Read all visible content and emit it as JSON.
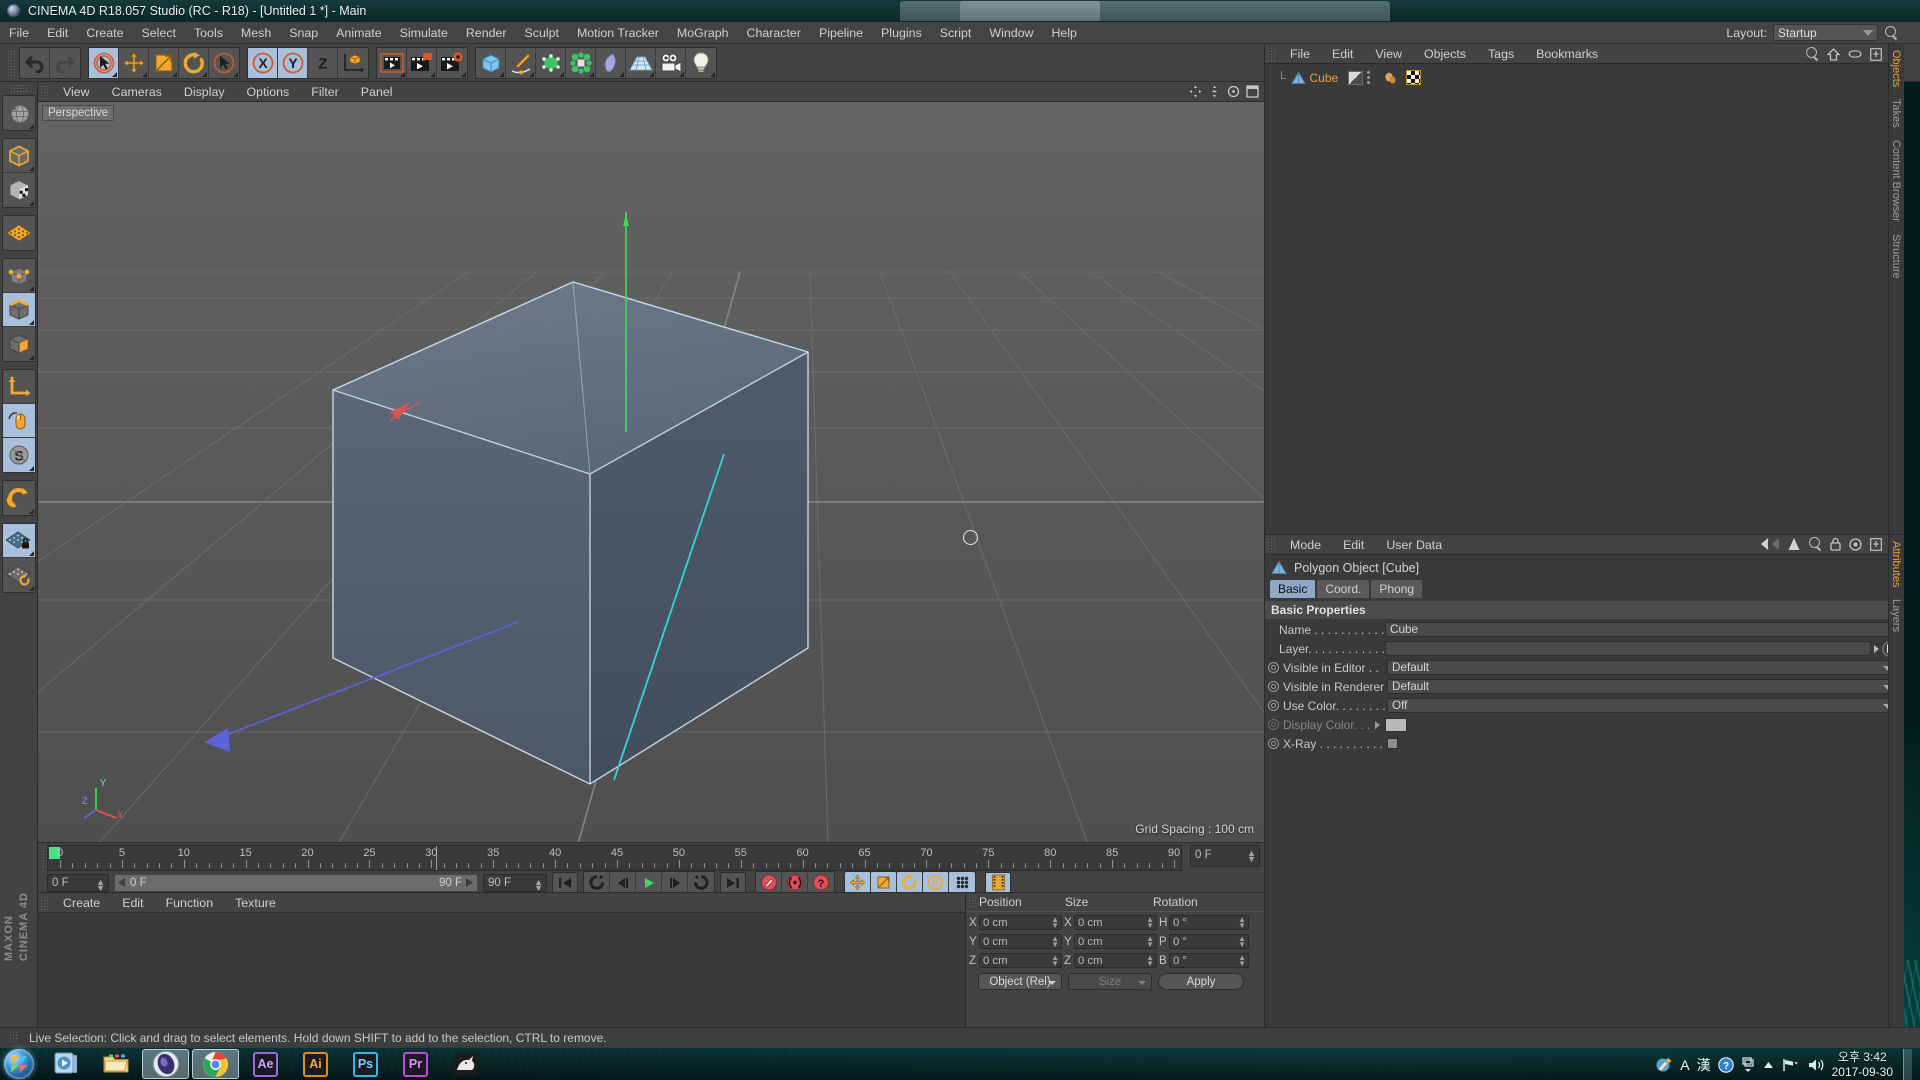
{
  "window": {
    "title": "CINEMA 4D R18.057 Studio (RC - R18) - [Untitled 1 *] - Main",
    "logo_icon": "c4d-logo"
  },
  "menubar": {
    "items": [
      "File",
      "Edit",
      "Create",
      "Select",
      "Tools",
      "Mesh",
      "Snap",
      "Animate",
      "Simulate",
      "Render",
      "Sculpt",
      "Motion Tracker",
      "MoGraph",
      "Character",
      "Pipeline",
      "Plugins",
      "Script",
      "Window",
      "Help"
    ],
    "layout_label": "Layout:",
    "layout_value": "Startup",
    "search_icon": "search-icon"
  },
  "toolbar": {
    "groups": [
      {
        "name": "history",
        "buttons": [
          {
            "icon": "undo-icon",
            "label": "Undo",
            "active": false
          },
          {
            "icon": "redo-icon",
            "label": "Redo",
            "active": false
          }
        ]
      },
      {
        "name": "selection-transform",
        "buttons": [
          {
            "icon": "live-selection-icon",
            "label": "Live Selection",
            "active": true
          },
          {
            "icon": "move-icon",
            "label": "Move",
            "active": false
          },
          {
            "icon": "scale-icon",
            "label": "Scale",
            "active": false
          },
          {
            "icon": "rotate-icon",
            "label": "Rotate",
            "active": false
          },
          {
            "icon": "cursor-select-icon",
            "label": "Selection Mode",
            "active": false
          }
        ]
      },
      {
        "name": "axis-lock",
        "buttons": [
          {
            "icon": "x-axis-icon",
            "label": "X",
            "active": true
          },
          {
            "icon": "y-axis-icon",
            "label": "Y",
            "active": true
          },
          {
            "icon": "z-axis-icon",
            "label": "Z",
            "active": false
          },
          {
            "icon": "world-object-axis-icon",
            "label": "World/Object",
            "active": false
          }
        ]
      },
      {
        "name": "render",
        "buttons": [
          {
            "icon": "render-view-icon",
            "label": "Render View",
            "active": false
          },
          {
            "icon": "render-region-icon",
            "label": "Render to Picture Viewer",
            "active": false
          },
          {
            "icon": "render-settings-icon",
            "label": "Edit Render Settings",
            "active": false
          }
        ]
      },
      {
        "name": "create",
        "buttons": [
          {
            "icon": "cube-primitive-icon",
            "label": "Add Cube Object",
            "active": false
          },
          {
            "icon": "spline-pen-icon",
            "label": "Add Spline",
            "active": false
          },
          {
            "icon": "generator-icon",
            "label": "Add Generator",
            "active": false
          },
          {
            "icon": "deformer-icon",
            "label": "Add Deformer",
            "active": false
          },
          {
            "icon": "environment-icon",
            "label": "Scene Object",
            "active": false
          },
          {
            "icon": "floor-icon",
            "label": "Scene Floor",
            "active": false
          },
          {
            "icon": "camera-icon",
            "label": "Add Camera",
            "active": false
          },
          {
            "icon": "light-icon",
            "label": "Add Light",
            "active": false
          }
        ]
      }
    ]
  },
  "leftbar": {
    "groups": [
      [
        {
          "icon": "globe-undo-icon",
          "label": "Undo View",
          "active": false
        }
      ],
      [
        {
          "icon": "model-mode-icon",
          "label": "Model Mode",
          "active": false
        },
        {
          "icon": "texture-mode-icon",
          "label": "Texture Mode",
          "active": false
        }
      ],
      [
        {
          "icon": "workplane-icon",
          "label": "Workplane",
          "active": false
        }
      ],
      [
        {
          "icon": "points-mode-icon",
          "label": "Points",
          "active": false
        },
        {
          "icon": "edges-mode-icon",
          "label": "Edges",
          "active": true
        },
        {
          "icon": "polygons-mode-icon",
          "label": "Polygons",
          "active": false
        }
      ],
      [
        {
          "icon": "axis-modify-icon",
          "label": "Enable Axis Modification",
          "active": false
        },
        {
          "icon": "viewport-solo-icon",
          "label": "Viewport Solo",
          "active": true
        },
        {
          "icon": "soft-selection-icon",
          "label": "Soft Selection",
          "active": true
        }
      ],
      [
        {
          "icon": "magnet-icon",
          "label": "Magnet",
          "active": false
        }
      ],
      [
        {
          "icon": "workplane-lock-icon",
          "label": "Lock Workplane",
          "active": true
        },
        {
          "icon": "workplane-rotate-icon",
          "label": "Planar Workplane",
          "active": false
        }
      ]
    ],
    "brand_line1": "MAXON",
    "brand_line2": "CINEMA 4D"
  },
  "viewport": {
    "menu": [
      "View",
      "Cameras",
      "Display",
      "Options",
      "Filter",
      "Panel"
    ],
    "label": "Perspective",
    "grid_spacing": "Grid Spacing : 100 cm",
    "axis_gizmo": {
      "x": "X",
      "y": "Y",
      "z": "Z"
    },
    "icons": [
      "pan-icon",
      "zoom-icon",
      "rotate-view-icon",
      "maximize-view-icon"
    ]
  },
  "timeline": {
    "ticks": [
      0,
      5,
      10,
      15,
      20,
      25,
      30,
      35,
      40,
      45,
      50,
      55,
      60,
      65,
      70,
      75,
      80,
      85,
      90
    ],
    "current_frame": "0 F",
    "range_start": "0 F",
    "range_end": "90 F",
    "preview_end": "90 F",
    "transport": [
      {
        "icon": "go-to-start-icon",
        "label": "Go to Start",
        "active": false
      },
      {
        "icon": "step-back-keyframe-icon",
        "label": "Go to Previous Key",
        "active": false
      },
      {
        "icon": "step-back-frame-icon",
        "label": "Go to Previous Frame",
        "active": false
      },
      {
        "icon": "play-icon",
        "label": "Play Forwards",
        "active": false
      },
      {
        "icon": "step-forward-frame-icon",
        "label": "Go to Next Frame",
        "active": false
      },
      {
        "icon": "step-forward-keyframe-icon",
        "label": "Go to Next Key",
        "active": false
      },
      {
        "icon": "go-to-end-icon",
        "label": "Go to End",
        "active": false
      }
    ],
    "record": [
      {
        "icon": "record-key-icon",
        "label": "Record Active Objects",
        "active": false
      },
      {
        "icon": "autokey-icon",
        "label": "Autokeying",
        "active": false
      },
      {
        "icon": "keyframe-selection-icon",
        "label": "Keyframe Selection",
        "active": false
      }
    ],
    "params": [
      {
        "icon": "key-position-icon",
        "label": "Position",
        "active": true
      },
      {
        "icon": "key-scale-icon",
        "label": "Scale",
        "active": true
      },
      {
        "icon": "key-rotation-icon",
        "label": "Rotation",
        "active": true
      },
      {
        "icon": "key-param-icon",
        "label": "Parameter",
        "active": true
      },
      {
        "icon": "key-pla-icon",
        "label": "Point Level Animation",
        "active": true
      }
    ],
    "extra": [
      {
        "icon": "timeline-toggle-icon",
        "label": "Animation Mode",
        "active": true
      }
    ]
  },
  "material_manager": {
    "menu": [
      "Create",
      "Edit",
      "Function",
      "Texture"
    ],
    "materials": []
  },
  "coordinates": {
    "headers": [
      "Position",
      "Size",
      "Rotation"
    ],
    "rows": [
      {
        "pos_axis": "X",
        "pos_value": "0 cm",
        "size_axis": "X",
        "size_value": "0 cm",
        "rot_axis": "H",
        "rot_value": "0 °"
      },
      {
        "pos_axis": "Y",
        "pos_value": "0 cm",
        "size_axis": "Y",
        "size_value": "0 cm",
        "rot_axis": "P",
        "rot_value": "0 °"
      },
      {
        "pos_axis": "Z",
        "pos_value": "0 cm",
        "size_axis": "Z",
        "size_value": "0 cm",
        "rot_axis": "B",
        "rot_value": "0 °"
      }
    ],
    "mode_dropdown": "Object (Rel)",
    "size_dropdown": "Size",
    "apply_button": "Apply"
  },
  "object_manager": {
    "menu": [
      "File",
      "Edit",
      "View",
      "Objects",
      "Tags",
      "Bookmarks"
    ],
    "header_icons": [
      "search-icon",
      "home-icon",
      "eye-icon",
      "fit-icon"
    ],
    "objects": [
      {
        "name": "Cube",
        "icon": "polygon-object-icon",
        "tags": [
          "display-tag",
          "phong-tag",
          "texture-tag"
        ]
      }
    ],
    "side_tabs": [
      "Objects",
      "Takes",
      "Content Browser",
      "Structure"
    ]
  },
  "attribute_manager": {
    "menu": [
      "Mode",
      "Edit",
      "User Data"
    ],
    "header_icons": [
      "back-icon",
      "forward-icon",
      "up-icon",
      "search-icon",
      "lock-icon",
      "target-icon",
      "fit-icon"
    ],
    "object_title": "Polygon Object [Cube]",
    "object_icon": "polygon-object-icon",
    "tabs": [
      {
        "label": "Basic",
        "active": true
      },
      {
        "label": "Coord.",
        "active": false
      },
      {
        "label": "Phong",
        "active": false
      }
    ],
    "section_title": "Basic Properties",
    "properties": [
      {
        "label": "Name . . . . . . . . . . .",
        "type": "text",
        "value": "Cube",
        "radio": false,
        "dim": false
      },
      {
        "label": "Layer. . . . . . . . . . . .",
        "type": "layer",
        "value": "",
        "radio": false,
        "dim": false
      },
      {
        "label": "Visible in Editor . .",
        "type": "dropdown",
        "value": "Default",
        "radio": true,
        "dim": false
      },
      {
        "label": "Visible in Renderer",
        "type": "dropdown",
        "value": "Default",
        "radio": true,
        "dim": false
      },
      {
        "label": "Use Color. . . . . . . .",
        "type": "dropdown",
        "value": "Off",
        "radio": true,
        "dim": false
      },
      {
        "label": "Display Color. . . ",
        "type": "color",
        "value": "",
        "radio": true,
        "dim": true
      },
      {
        "label": "X-Ray . . . . . . . . . . .",
        "type": "checkbox",
        "value": "",
        "radio": true,
        "dim": false
      }
    ],
    "side_tabs": [
      "Attributes",
      "Layers"
    ]
  },
  "statusbar": {
    "message": "Live Selection: Click and drag to select elements. Hold down SHIFT to add to the selection, CTRL to remove."
  },
  "taskbar": {
    "start_label": "Start",
    "items": [
      {
        "icon": "windows-media-player-icon",
        "label": "Windows Media Player",
        "active": false
      },
      {
        "icon": "file-explorer-icon",
        "label": "File Explorer",
        "active": false
      },
      {
        "icon": "cinema4d-icon",
        "label": "CINEMA 4D",
        "active": true
      },
      {
        "icon": "chrome-icon",
        "label": "Google Chrome",
        "active": true
      },
      {
        "icon": "after-effects-icon",
        "label": "Ae",
        "active": false
      },
      {
        "icon": "illustrator-icon",
        "label": "Ai",
        "active": false
      },
      {
        "icon": "photoshop-icon",
        "label": "Ps",
        "active": false
      },
      {
        "icon": "premiere-icon",
        "label": "Pr",
        "active": false
      },
      {
        "icon": "rhino-icon",
        "label": "Rhinoceros",
        "active": false
      }
    ],
    "tray": {
      "icons": [
        "ime-pencil-icon",
        "ime-a-icon",
        "ime-han-icon",
        "ime-help-icon",
        "ime-keyboard-icon",
        "show-hidden-icon",
        "network-icon",
        "volume-icon"
      ],
      "ime_a": "A",
      "ime_han": "漢",
      "time": "오후 3:42",
      "date": "2017-09-30"
    }
  },
  "colors": {
    "accent_orange": "#e8a33d",
    "selection_blue": "#a8c0dc",
    "panel_bg": "#3a3a3a",
    "toolbar_bg": "#434343",
    "viewport_bg": "#5c5c5c",
    "cube_fill": "#5d6a7a",
    "edge_cyan": "#2fd6d6"
  }
}
